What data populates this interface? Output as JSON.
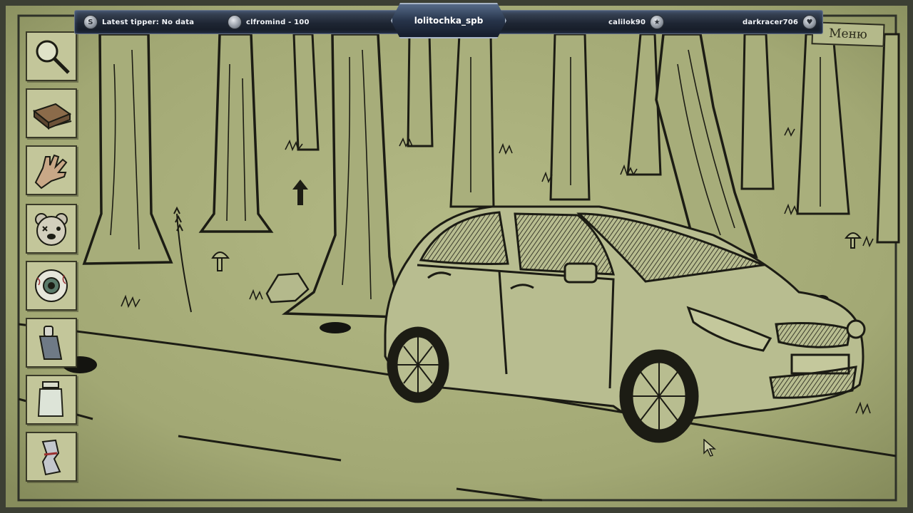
{
  "stream_bar": {
    "left_text": "Latest tipper: No data",
    "left_coin": "S",
    "user1": "clfromind - 100",
    "center_user": "lolitochka_spb",
    "user3": "calilok90",
    "user4": "darkracer706"
  },
  "game": {
    "menu_label": "Меню"
  },
  "inventory": [
    {
      "icon": "magnifier-icon"
    },
    {
      "icon": "matchbox-icon"
    },
    {
      "icon": "glove-icon"
    },
    {
      "icon": "teddy-bear-head-icon"
    },
    {
      "icon": "eyeball-icon"
    },
    {
      "icon": "lipstick-icon"
    },
    {
      "icon": "jar-icon"
    },
    {
      "icon": "crushed-can-icon"
    }
  ],
  "colors": {
    "paper": "#a5ab78",
    "ink": "#1c1c14",
    "frame": "#3c3f34"
  }
}
